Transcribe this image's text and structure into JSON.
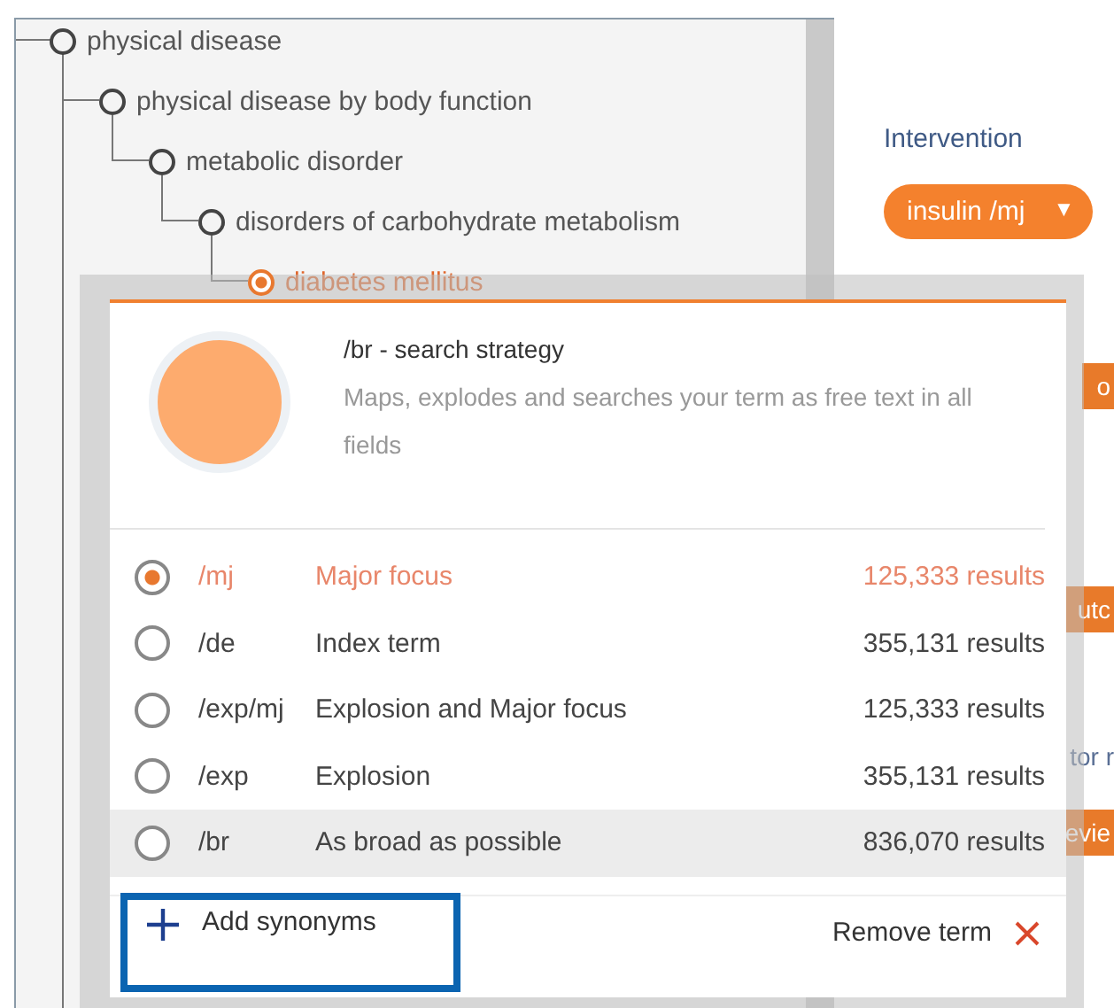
{
  "tree": [
    {
      "label": "physical disease",
      "selected": false,
      "children": [
        {
          "label": "physical disease by body function",
          "selected": false,
          "children": [
            {
              "label": "metabolic disorder",
              "selected": false,
              "children": [
                {
                  "label": "disorders of carbohydrate metabolism",
                  "selected": false,
                  "children": [
                    {
                      "label": "diabetes mellitus",
                      "selected": true
                    }
                  ]
                }
              ]
            }
          ]
        }
      ]
    }
  ],
  "intervention": {
    "label": "Intervention",
    "value": "insulin /mj",
    "caret": "▼"
  },
  "side_fragments": [
    {
      "kind": "button",
      "text": "o"
    },
    {
      "kind": "button",
      "text": "utc"
    },
    {
      "kind": "text",
      "text": "tor r"
    },
    {
      "kind": "button",
      "text": "evie"
    }
  ],
  "popup": {
    "title": "/br - search strategy",
    "description": "Maps, explodes and searches your term as free text in all fields",
    "options": [
      {
        "code": "/mj",
        "label": "Major focus",
        "results": "125,333 results",
        "selected": true,
        "hovered": false
      },
      {
        "code": "/de",
        "label": "Index term",
        "results": "355,131 results",
        "selected": false,
        "hovered": false
      },
      {
        "code": "/exp/mj",
        "label": "Explosion and Major focus",
        "results": "125,333 results",
        "selected": false,
        "hovered": false
      },
      {
        "code": "/exp",
        "label": "Explosion",
        "results": "355,131 results",
        "selected": false,
        "hovered": false
      },
      {
        "code": "/br",
        "label": "As broad as possible",
        "results": "836,070 results",
        "selected": false,
        "hovered": true
      }
    ],
    "add_label": "Add synonyms",
    "add_highlighted": true,
    "remove_label": "Remove term"
  }
}
